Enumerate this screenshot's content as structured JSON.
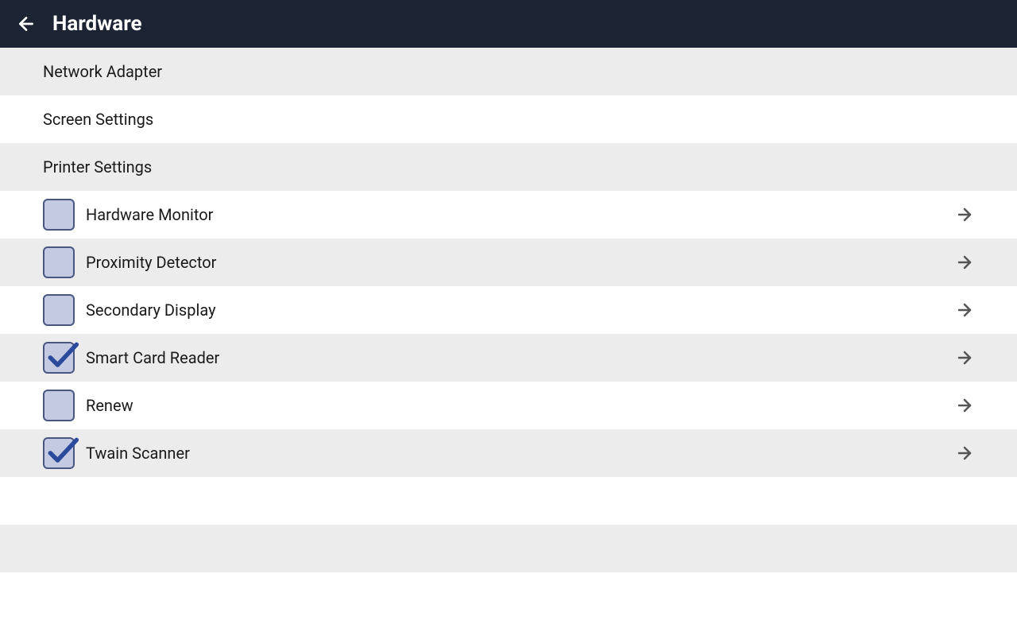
{
  "header": {
    "title": "Hardware"
  },
  "rows": [
    {
      "label": "Network Adapter",
      "checkbox": false,
      "arrow": false,
      "grey": true
    },
    {
      "label": "Screen Settings",
      "checkbox": false,
      "arrow": false,
      "grey": false
    },
    {
      "label": "Printer Settings",
      "checkbox": false,
      "arrow": false,
      "grey": true
    },
    {
      "label": "Hardware Monitor",
      "checkbox": true,
      "checked": false,
      "arrow": true,
      "grey": false
    },
    {
      "label": "Proximity Detector",
      "checkbox": true,
      "checked": false,
      "arrow": true,
      "grey": true
    },
    {
      "label": "Secondary Display",
      "checkbox": true,
      "checked": false,
      "arrow": true,
      "grey": false
    },
    {
      "label": "Smart Card Reader",
      "checkbox": true,
      "checked": true,
      "arrow": true,
      "grey": true
    },
    {
      "label": "Renew",
      "checkbox": true,
      "checked": false,
      "arrow": true,
      "grey": false
    },
    {
      "label": "Twain Scanner",
      "checkbox": true,
      "checked": true,
      "arrow": true,
      "grey": true
    }
  ],
  "spacer1": "",
  "spacer2": "",
  "spacer3": ""
}
